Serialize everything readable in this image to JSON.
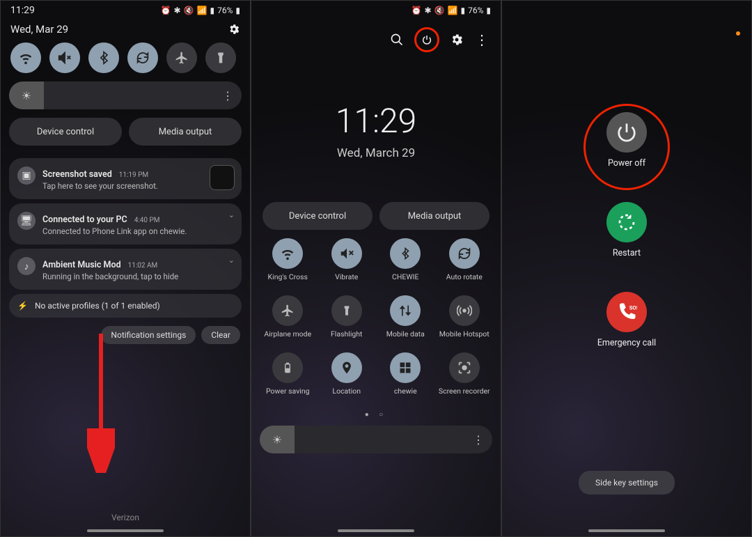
{
  "status": {
    "time": "11:29",
    "battery": "76%"
  },
  "pane1": {
    "date": "Wed, Mar 29",
    "qs": [
      "wifi",
      "mute",
      "bluetooth",
      "rotate",
      "airplane",
      "flashlight"
    ],
    "device_control": "Device control",
    "media_output": "Media output",
    "notifs": [
      {
        "icon": "image",
        "title": "Screenshot saved",
        "time": "11:19 PM",
        "body": "Tap here to see your screenshot.",
        "thumb": true
      },
      {
        "icon": "pc",
        "title": "Connected to your PC",
        "time": "4:40 PM",
        "body": "Connected to Phone Link app on chewie."
      },
      {
        "icon": "music",
        "title": "Ambient Music Mod",
        "time": "11:02 AM",
        "body": "Running in the background, tap to hide"
      }
    ],
    "profiles": "No active profiles (1 of 1 enabled)",
    "notif_settings": "Notification settings",
    "clear": "Clear",
    "carrier": "Verizon"
  },
  "pane2": {
    "time": "11:29",
    "date": "Wed, March 29",
    "device_control": "Device control",
    "media_output": "Media output",
    "tiles": [
      {
        "icon": "wifi",
        "label": "King's Cross",
        "on": true
      },
      {
        "icon": "mute",
        "label": "Vibrate",
        "on": true
      },
      {
        "icon": "bluetooth",
        "label": "CHEWIE",
        "on": true
      },
      {
        "icon": "rotate",
        "label": "Auto rotate",
        "on": true
      },
      {
        "icon": "airplane",
        "label": "Airplane mode",
        "on": false
      },
      {
        "icon": "flashlight",
        "label": "Flashlight",
        "on": false
      },
      {
        "icon": "data",
        "label": "Mobile data",
        "on": true
      },
      {
        "icon": "hotspot",
        "label": "Mobile Hotspot",
        "on": false
      },
      {
        "icon": "battery",
        "label": "Power saving",
        "on": false
      },
      {
        "icon": "location",
        "label": "Location",
        "on": true
      },
      {
        "icon": "windows",
        "label": "chewie",
        "on": true
      },
      {
        "icon": "record",
        "label": "Screen recorder",
        "on": false
      }
    ]
  },
  "pane3": {
    "power_off": "Power off",
    "restart": "Restart",
    "emergency": "Emergency call",
    "side_key": "Side key settings"
  }
}
